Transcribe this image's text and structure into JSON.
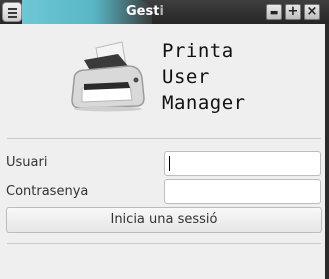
{
  "window": {
    "title": "Gesti",
    "buttons": {
      "minimize": "▬",
      "maximize": "+",
      "close": "×"
    }
  },
  "header": {
    "app_name_lines": [
      "Printa",
      "User",
      "Manager"
    ],
    "logo_icon": "printer-icon"
  },
  "form": {
    "username_label": "Usuari",
    "username_value": "",
    "password_label": "Contrasenya",
    "password_value": "",
    "login_button": "Inicia una sessió"
  },
  "colors": {
    "title_accent": "#58b7c6",
    "titlebar": "#2e2e2e",
    "window_bg": "#efefef"
  }
}
